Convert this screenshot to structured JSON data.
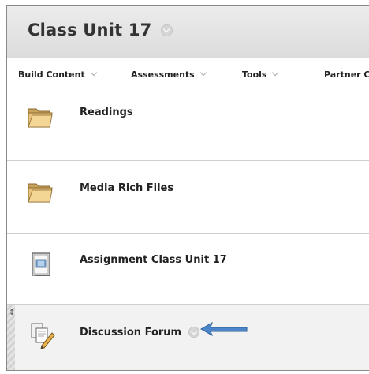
{
  "page": {
    "title": "Class Unit 17"
  },
  "toolbar": {
    "items": [
      {
        "label": "Build Content"
      },
      {
        "label": "Assessments"
      },
      {
        "label": "Tools"
      },
      {
        "label": "Partner C"
      }
    ]
  },
  "content": {
    "items": [
      {
        "label": "Readings",
        "icon": "folder-icon"
      },
      {
        "label": "Media Rich Files",
        "icon": "folder-icon"
      },
      {
        "label": "Assignment Class Unit 17",
        "icon": "assignment-icon"
      },
      {
        "label": "Discussion Forum",
        "icon": "discussion-forum-icon",
        "drag_handle": "↕"
      }
    ]
  },
  "colors": {
    "header_bg": "#e4e4e4",
    "arrow": "#4a86c8",
    "folder": "#e9c37a"
  }
}
